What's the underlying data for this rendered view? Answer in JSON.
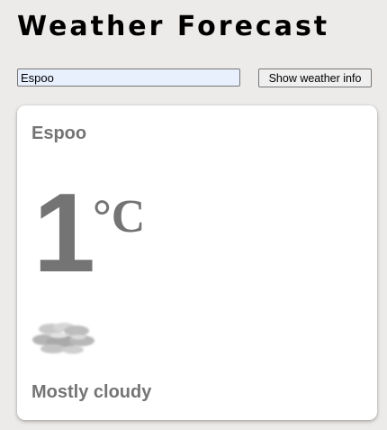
{
  "page": {
    "title": "Weather Forecast"
  },
  "search": {
    "value": "Espoo",
    "button_label": "Show weather info"
  },
  "card": {
    "city": "Espoo",
    "temperature": "1",
    "unit": "°C",
    "icon": "cloud-icon",
    "condition": "Mostly cloudy"
  },
  "colors": {
    "background": "#edebe9",
    "card": "#ffffff",
    "muted_text": "#747474",
    "input_autofill": "#e8f0fe"
  }
}
